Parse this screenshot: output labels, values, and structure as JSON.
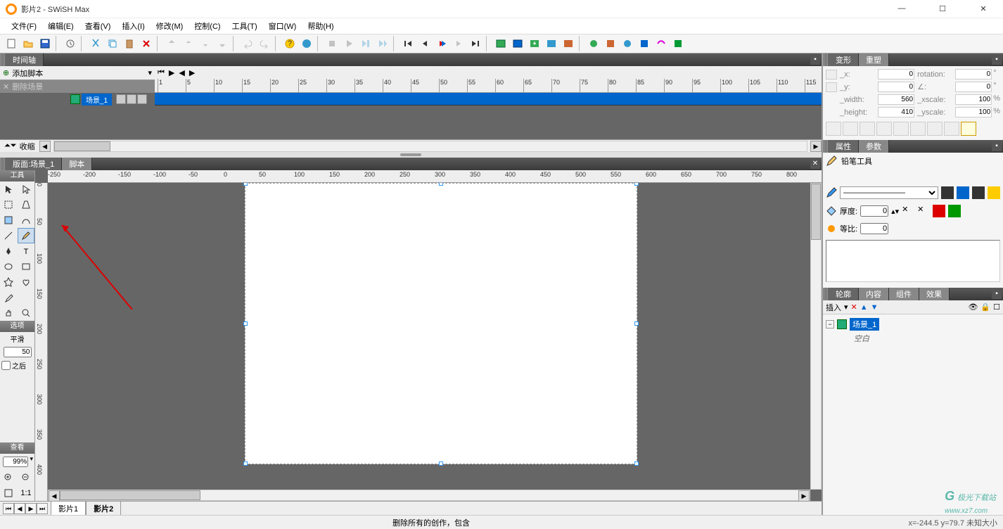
{
  "window": {
    "title": "影片2 - SWiSH Max",
    "minimize": "—",
    "maximize": "☐",
    "close": "✕"
  },
  "menu": {
    "file": "文件(F)",
    "edit": "编辑(E)",
    "view": "查看(V)",
    "insert": "插入(I)",
    "modify": "修改(M)",
    "control": "控制(C)",
    "tools": "工具(T)",
    "window": "窗口(W)",
    "help": "帮助(H)"
  },
  "timeline": {
    "panel_label": "时间轴",
    "add_script": "添加脚本",
    "delete_scene": "删除场景",
    "scene_label": "场景_1",
    "collapse": "收缩",
    "ruler_marks": [
      "1",
      "5",
      "10",
      "15",
      "20",
      "25",
      "30",
      "35",
      "40",
      "45",
      "50",
      "55",
      "60",
      "65",
      "70",
      "75",
      "80",
      "85",
      "90",
      "95",
      "100",
      "105",
      "110",
      "115"
    ]
  },
  "layout": {
    "panel_prefix": "版面: ",
    "panel_scene": "场景_1",
    "script_tab": "脚本",
    "tools_header": "工具",
    "options_header": "选项",
    "smooth_label": "平滑",
    "smooth_value": "50",
    "after_label": "之后",
    "view_header": "查看",
    "zoom_value": "99%",
    "ruler_h": [
      "-250",
      "-200",
      "-150",
      "-100",
      "-50",
      "0",
      "50",
      "100",
      "150",
      "200",
      "250",
      "300",
      "350",
      "400",
      "450",
      "500",
      "550",
      "600",
      "650",
      "700",
      "750",
      "800"
    ],
    "ruler_v": [
      "0",
      "50",
      "100",
      "150",
      "200",
      "250",
      "300",
      "350",
      "400"
    ]
  },
  "tabs": {
    "movie1": "影片1",
    "movie2": "影片2"
  },
  "status": {
    "message": "删除所有的创作，包含",
    "coords": "x=-244.5 y=79.7 未知大小"
  },
  "transform": {
    "tab_transform": "变形",
    "tab_reshape": "重塑",
    "x_label": "_x:",
    "x_value": "0",
    "rotation_label": "rotation:",
    "rotation_value": "0",
    "rotation_unit": "°",
    "y_label": "_y:",
    "y_value": "0",
    "skew_label": "∠:",
    "skew_value": "0",
    "skew_unit": "°",
    "width_label": "_width:",
    "width_value": "560",
    "xscale_label": "_xscale:",
    "xscale_value": "100",
    "xscale_unit": "%",
    "height_label": "_height:",
    "height_value": "410",
    "yscale_label": "_yscale:",
    "yscale_value": "100",
    "yscale_unit": "%"
  },
  "properties": {
    "tab_props": "属性",
    "tab_params": "参数",
    "tool_name": "铅笔工具",
    "thickness_label": "厚度:",
    "thickness_value": "0",
    "ratio_label": "等比:",
    "ratio_value": "0"
  },
  "outline": {
    "tab_outline": "轮廓",
    "tab_content": "内容",
    "tab_components": "组件",
    "tab_effects": "效果",
    "insert_label": "插入",
    "scene_label": "场景_1",
    "empty_label": "空白"
  },
  "watermark": {
    "brand": "极光下载站",
    "url": "www.xz7.com"
  }
}
